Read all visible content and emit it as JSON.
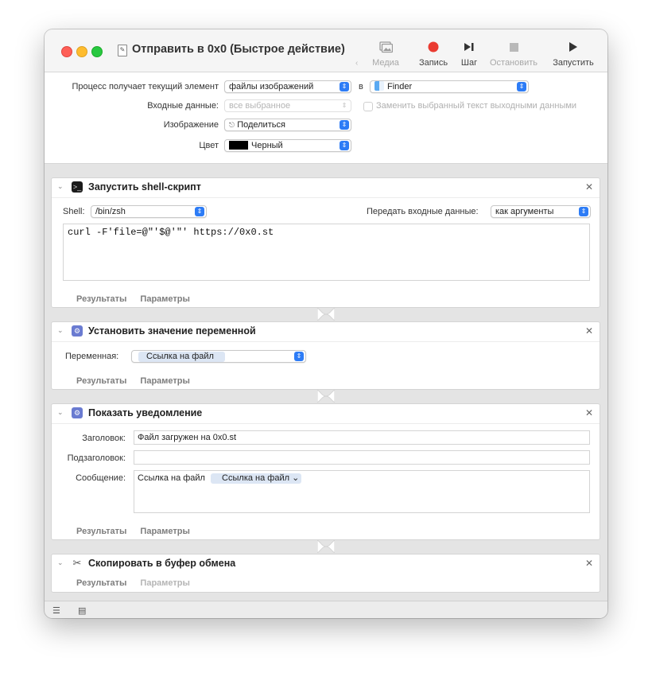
{
  "window": {
    "title": "Отправить в 0x0 (Быстрое действие)"
  },
  "toolbar": {
    "media_label": "Медиа",
    "record_label": "Запись",
    "step_label": "Шаг",
    "stop_label": "Остановить",
    "run_label": "Запустить",
    "colors": {
      "record": "#ea3b31"
    }
  },
  "settings": {
    "receives_label": "Процесс получает текущий элемент",
    "receives_value": "файлы изображений",
    "in_label": "в",
    "app_value": "Finder",
    "input_label": "Входные данные:",
    "input_value": "все выбранное",
    "replace_label": "Заменить выбранный текст выходными данными",
    "image_label": "Изображение",
    "image_value": "Поделиться",
    "color_label": "Цвет",
    "color_value": "Черный"
  },
  "actions": [
    {
      "title": "Запустить shell-скрипт",
      "shell_label": "Shell:",
      "shell_value": "/bin/zsh",
      "pass_label": "Передать входные данные:",
      "pass_value": "как аргументы",
      "script": "curl -F'file=@\"'$@'\"' https://0x0.st",
      "results_label": "Результаты",
      "options_label": "Параметры"
    },
    {
      "title": "Установить значение переменной",
      "variable_label": "Переменная:",
      "variable_value": "Ссылка на файл",
      "results_label": "Результаты",
      "options_label": "Параметры"
    },
    {
      "title": "Показать уведомление",
      "header_label": "Заголовок:",
      "header_value": "Файл загружен на 0x0.st",
      "subheader_label": "Подзаголовок:",
      "subheader_value": "",
      "message_label": "Сообщение:",
      "message_text": "Ссылка на файл",
      "message_token": "Ссылка на файл ⌄",
      "results_label": "Результаты",
      "options_label": "Параметры"
    },
    {
      "title": "Скопировать в буфер обмена",
      "results_label": "Результаты",
      "options_label": "Параметры"
    }
  ]
}
